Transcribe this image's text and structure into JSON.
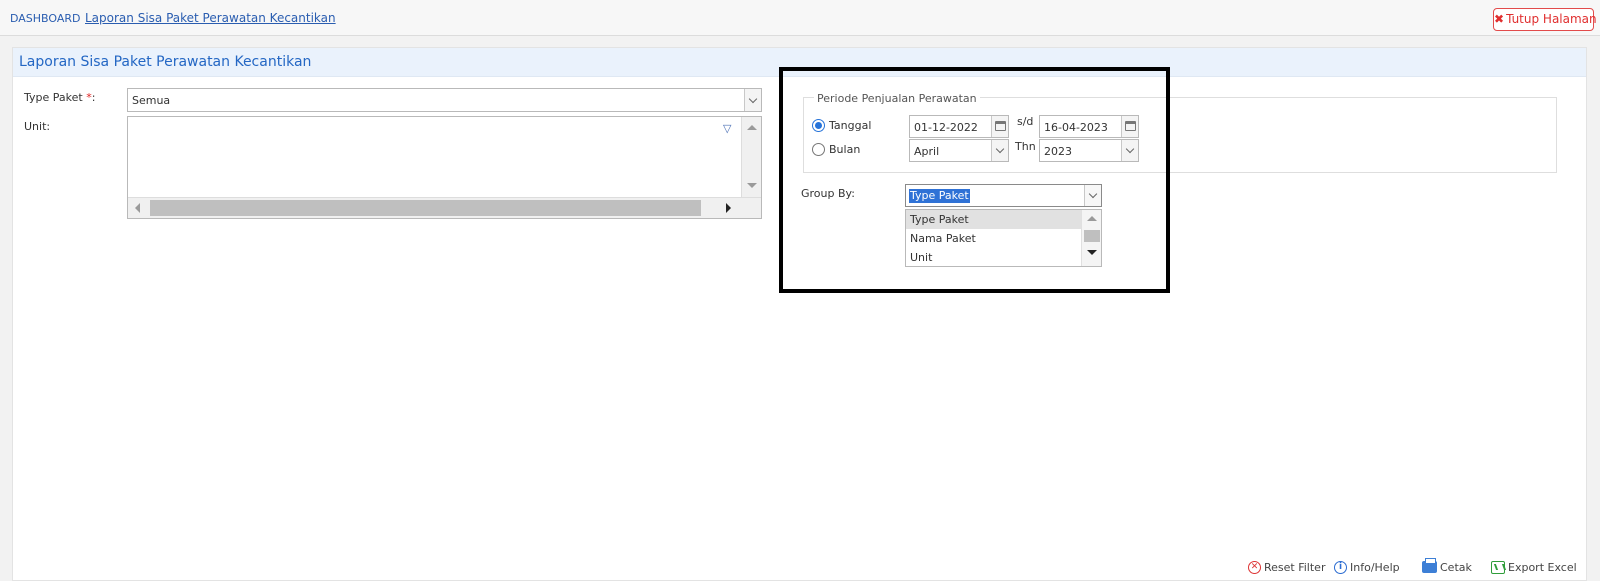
{
  "breadcrumb": {
    "home": "DASHBOARD",
    "current": "Laporan Sisa Paket Perawatan Kecantikan"
  },
  "close_button": {
    "icon": "close-icon",
    "label": "Tutup Halaman"
  },
  "panel": {
    "title": "Laporan Sisa Paket Perawatan Kecantikan"
  },
  "form": {
    "type_paket": {
      "label": "Type Paket",
      "required_mark": "*",
      "colon": ":",
      "value": "Semua"
    },
    "unit": {
      "label": "Unit:",
      "filter_icon": "filter-icon"
    }
  },
  "periode": {
    "legend": "Periode Penjualan Perawatan",
    "tanggal": {
      "label": "Tanggal",
      "selected": true,
      "from": "01-12-2022",
      "to_label": "s/d",
      "to": "16-04-2023"
    },
    "bulan": {
      "label": "Bulan",
      "selected": false,
      "month": "April",
      "year_label": "Thn",
      "year": "2023"
    }
  },
  "group_by": {
    "label": "Group By:",
    "value": "Type Paket",
    "options": [
      "Type Paket",
      "Nama Paket",
      "Unit"
    ],
    "active_index": 0
  },
  "footer": {
    "reset": {
      "icon": "reset-icon",
      "label": "Reset Filter"
    },
    "info": {
      "icon": "info-icon",
      "label": "Info/Help"
    },
    "print": {
      "icon": "printer-icon",
      "label": "Cetak"
    },
    "excel": {
      "icon": "excel-icon",
      "label": "Export Excel"
    }
  },
  "colors": {
    "accent": "#2467c4",
    "close": "#e02f2f",
    "highlight_border": "#000000",
    "selection": "#2f72d6"
  }
}
